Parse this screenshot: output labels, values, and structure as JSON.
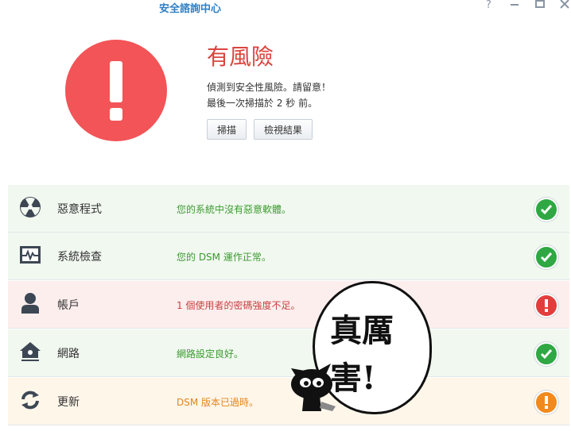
{
  "window": {
    "title": "安全諮詢中心",
    "help_icon": "help-icon",
    "minimize_icon": "minimize-icon",
    "maximize_icon": "maximize-icon",
    "close_icon": "close-icon"
  },
  "summary": {
    "status": "有風險",
    "line1": "偵測到安全性風險。請留意！",
    "line2": "最後一次掃描於 2 秒 前。",
    "scan_button": "掃描",
    "results_button": "檢視結果",
    "status_color": "#f25457"
  },
  "categories": [
    {
      "label": "惡意程式",
      "message": "您的系統中沒有惡意軟體。",
      "status": "ok",
      "icon": "radiation-icon"
    },
    {
      "label": "系統檢查",
      "message": "您的 DSM 運作正常。",
      "status": "ok",
      "icon": "system-monitor-icon"
    },
    {
      "label": "帳戶",
      "message": "1 個使用者的密碼強度不足。",
      "status": "danger",
      "icon": "user-icon"
    },
    {
      "label": "網路",
      "message": "網路設定良好。",
      "status": "ok",
      "icon": "home-network-icon"
    },
    {
      "label": "更新",
      "message": "DSM 版本已過時。",
      "status": "warning",
      "icon": "refresh-icon"
    }
  ],
  "sticker": {
    "line1": "真厲",
    "line2": "害!"
  },
  "colors": {
    "ok": "#2fa844",
    "danger": "#e23d3d",
    "warning": "#f08a1c"
  }
}
